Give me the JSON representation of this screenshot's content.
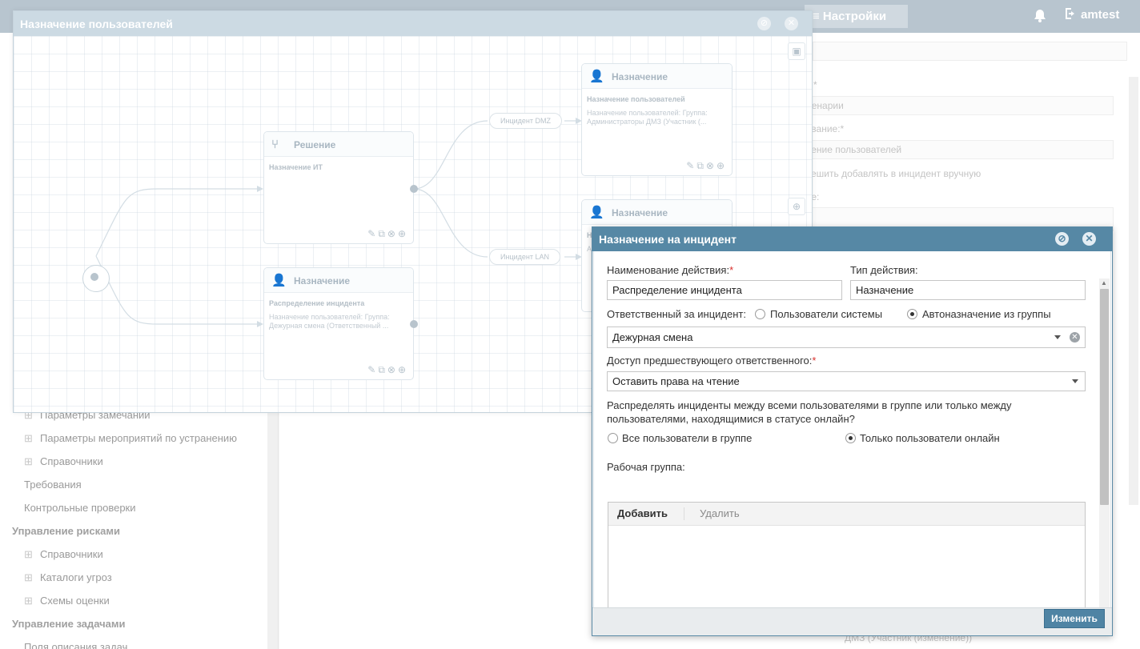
{
  "header": {
    "settings_label": "≡ Настройки",
    "bell_icon": "bell-icon",
    "user_label": "amtest"
  },
  "sidebar": {
    "items": [
      {
        "label": "Параметры замечаний",
        "kind": "plus"
      },
      {
        "label": "Параметры мероприятий по устранению",
        "kind": "plus"
      },
      {
        "label": "Справочники",
        "kind": "plus"
      },
      {
        "label": "Требования",
        "kind": "plain"
      },
      {
        "label": "Контрольные проверки",
        "kind": "plain"
      },
      {
        "label": "Управление рисками",
        "kind": "head"
      },
      {
        "label": "Справочники",
        "kind": "plus"
      },
      {
        "label": "Каталоги угроз",
        "kind": "plus"
      },
      {
        "label": "Схемы оценки",
        "kind": "plus"
      },
      {
        "label": "Управление задачами",
        "kind": "head"
      },
      {
        "label": "Поля описания задач",
        "kind": "plain"
      }
    ]
  },
  "background_form": {
    "field1": "ценарии",
    "label2": "нование:*",
    "field2": "чение пользователей",
    "label3": "ешить добавлять в инцидент вручную",
    "label4": "ние:",
    "footer_text": "ДМЗ (Участник (изменение))"
  },
  "scenario_window": {
    "title": "Назначение пользователей",
    "nodes": {
      "decision": {
        "title": "Решение",
        "subtitle": "Назначение ИТ",
        "desc": ""
      },
      "assign_dist": {
        "title": "Назначение",
        "subtitle": "Распределение инцидента",
        "desc": "Назначение пользователей: Группа: Дежурная смена (Ответственный ..."
      },
      "assign_top": {
        "title": "Назначение",
        "subtitle": "Назначение пользователей",
        "desc": "Назначение пользователей: Группа: Администраторы ДМЗ (Участник (..."
      },
      "assign_mid": {
        "title": "Назначение",
        "subtitle": "Н",
        "desc": "А"
      }
    },
    "edge_labels": {
      "dmz": "Инцидент DMZ",
      "lan": "Инцидент LAN"
    }
  },
  "dialog": {
    "title": "Назначение на инцидент",
    "action_name_label": "Наименование действия:",
    "action_name_value": "Распределение инцидента",
    "action_type_label": "Тип действия:",
    "action_type_value": "Назначение",
    "responsible_label": "Ответственный за инцидент:",
    "responsible_option_users": "Пользователи системы",
    "responsible_option_group": "Автоназначение из группы",
    "group_value": "Дежурная смена",
    "prev_access_label": "Доступ предшествующего ответственного:",
    "prev_access_value": "Оставить права на чтение",
    "distribute_question": "Распределять инциденты между всеми пользователями в группе или только между пользователями, находящимися в статусе онлайн?",
    "distribute_all": "Все пользователи в группе",
    "distribute_online": "Только пользователи онлайн",
    "workgroup_label": "Рабочая группа:",
    "add_label": "Добавить",
    "delete_label": "Удалить",
    "change_button": "Изменить"
  }
}
